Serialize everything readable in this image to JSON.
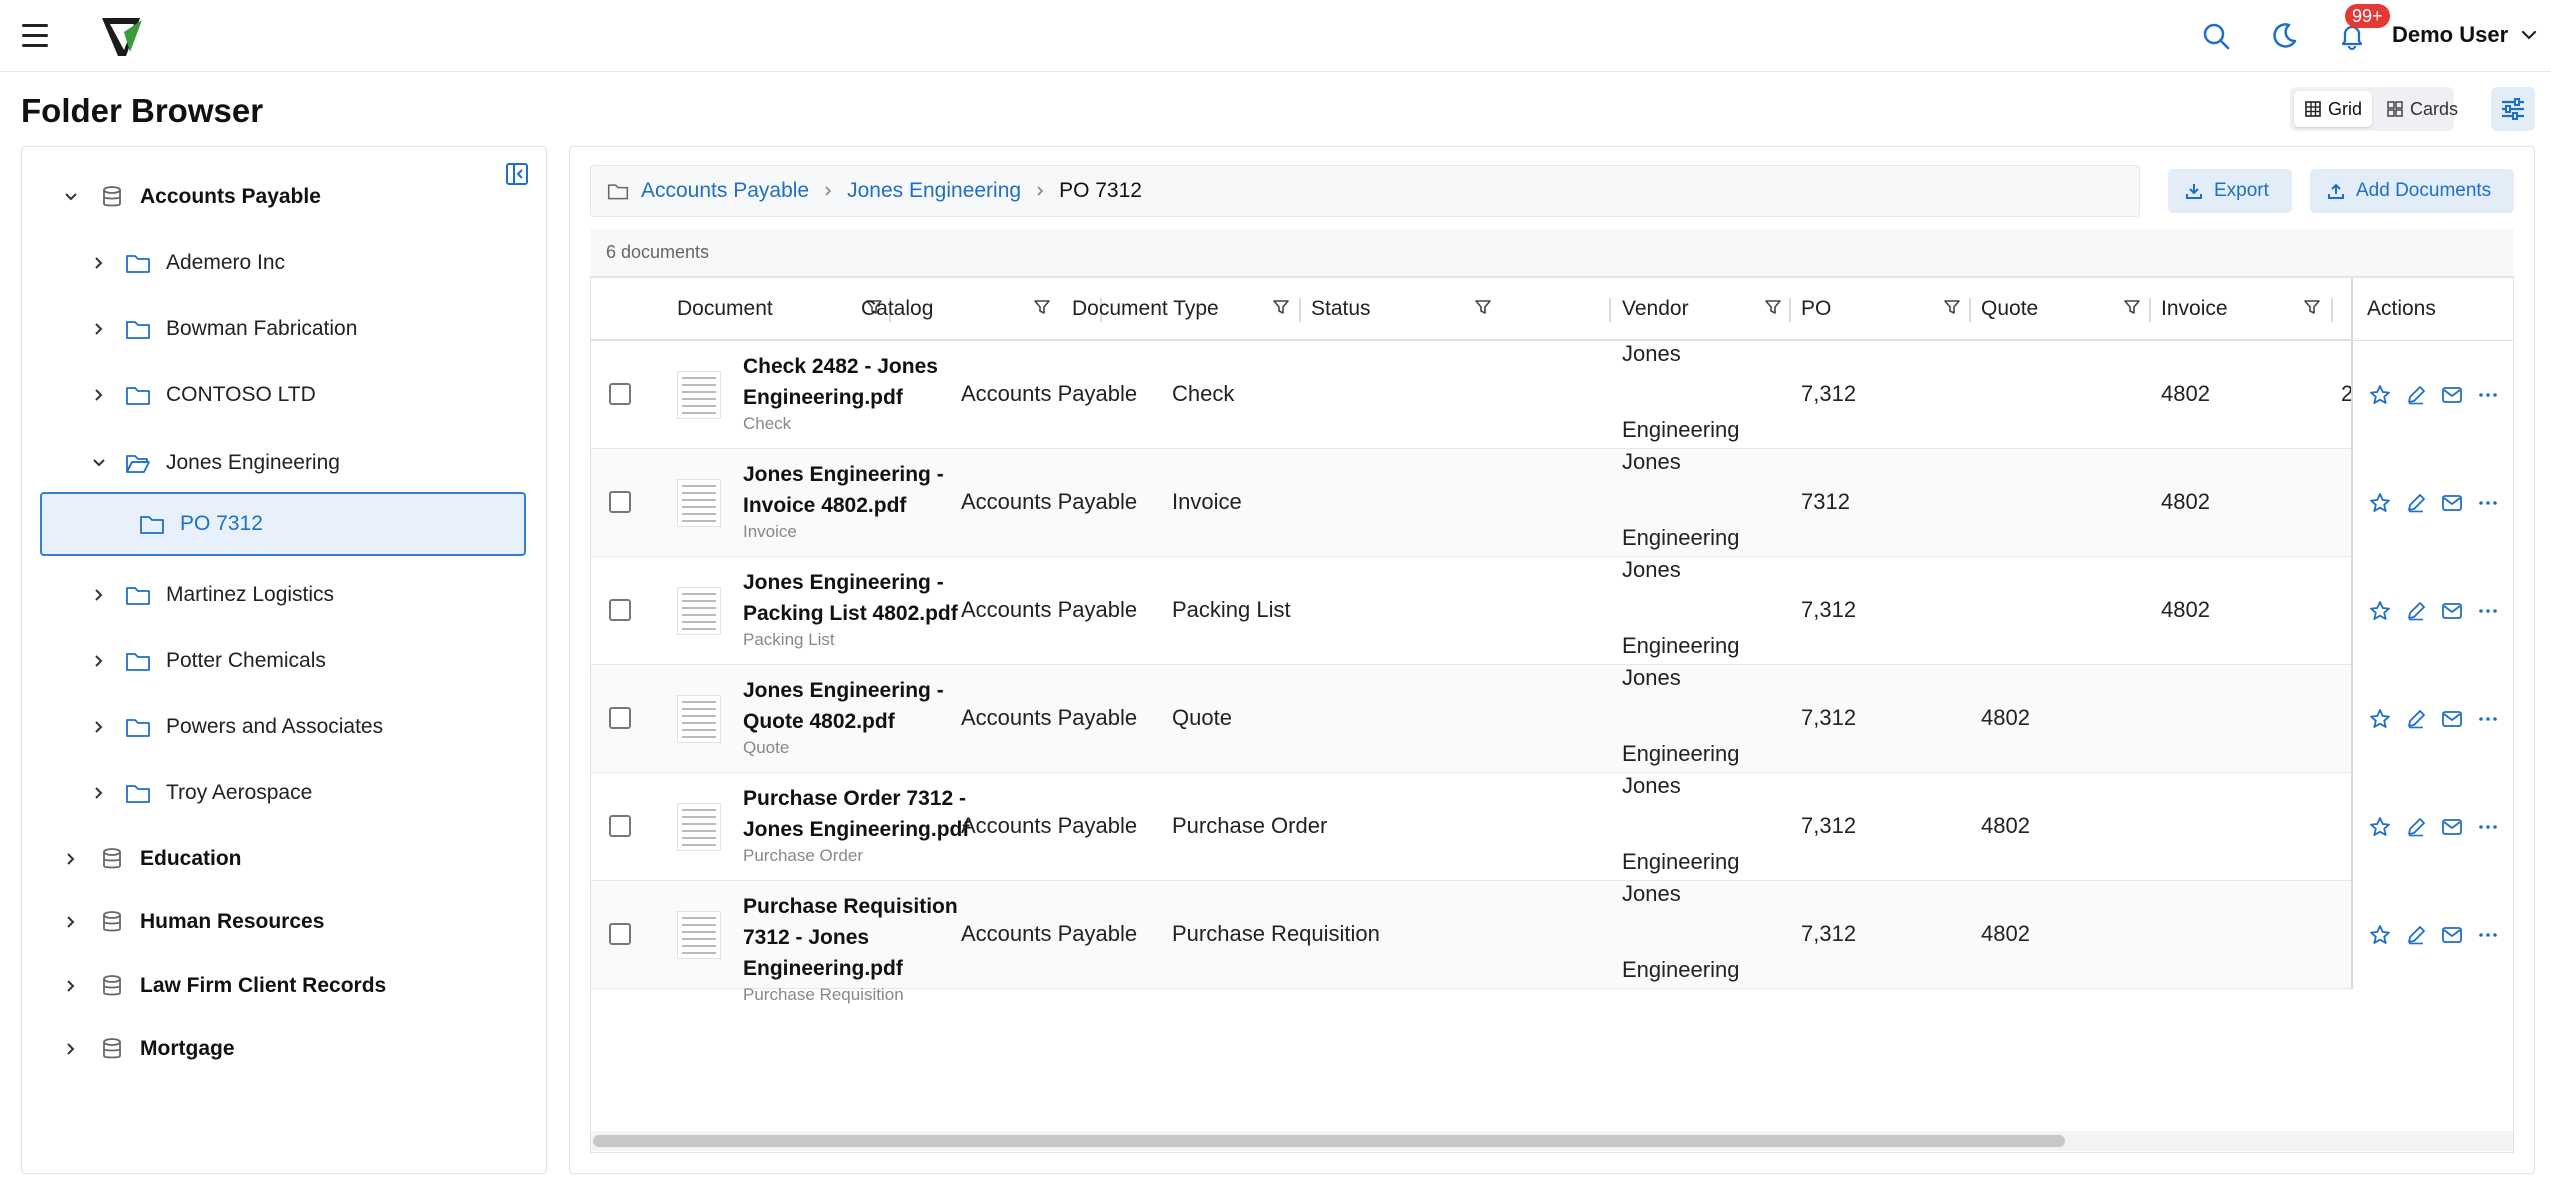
{
  "header": {
    "user_name": "Demo User",
    "notification_count": "99+",
    "icons": [
      "menu-icon",
      "search-icon",
      "moon-icon",
      "bell-icon",
      "chevron-down-icon"
    ]
  },
  "page": {
    "title": "Folder Browser",
    "view_grid_label": "Grid",
    "view_cards_label": "Cards"
  },
  "tree": {
    "roots": [
      {
        "label": "Accounts Payable",
        "expanded": true
      },
      {
        "label": "Education",
        "expanded": false
      },
      {
        "label": "Human Resources",
        "expanded": false
      },
      {
        "label": "Law Firm Client Records",
        "expanded": false
      },
      {
        "label": "Mortgage",
        "expanded": false
      }
    ],
    "children": [
      {
        "label": "Ademero Inc"
      },
      {
        "label": "Bowman Fabrication"
      },
      {
        "label": "CONTOSO LTD"
      },
      {
        "label": "Jones Engineering",
        "expanded": true
      },
      {
        "label": "PO 7312",
        "selected": true
      },
      {
        "label": "Martinez Logistics"
      },
      {
        "label": "Potter Chemicals"
      },
      {
        "label": "Powers and Associates"
      },
      {
        "label": "Troy Aerospace"
      }
    ]
  },
  "breadcrumb": {
    "items": [
      "Accounts Payable",
      "Jones Engineering"
    ],
    "current": "PO 7312"
  },
  "toolbar": {
    "export_label": "Export",
    "add_label": "Add Documents"
  },
  "doc_count": "6 documents",
  "columns": [
    "Document",
    "Catalog",
    "Document Type",
    "Status",
    "Vendor",
    "PO",
    "Quote",
    "Invoice",
    "Actions"
  ],
  "rows": [
    {
      "name": "Check 2482 - Jones Engineering.pdf",
      "sub": "Check",
      "catalog": "Accounts Payable",
      "type": "Check",
      "status": "",
      "vendor1": "Jones",
      "vendor2": "Engineering",
      "po": "7,312",
      "quote": "",
      "invoice": "4802",
      "cut": "2"
    },
    {
      "name": "Jones Engineering - Invoice 4802.pdf",
      "sub": "Invoice",
      "catalog": "Accounts Payable",
      "type": "Invoice",
      "status": "",
      "vendor1": "Jones",
      "vendor2": "Engineering",
      "po": "7312",
      "quote": "",
      "invoice": "4802",
      "cut": ""
    },
    {
      "name": "Jones Engineering - Packing List 4802.pdf",
      "sub": "Packing List",
      "catalog": "Accounts Payable",
      "type": "Packing List",
      "status": "",
      "vendor1": "Jones",
      "vendor2": "Engineering",
      "po": "7,312",
      "quote": "",
      "invoice": "4802",
      "cut": ""
    },
    {
      "name": "Jones Engineering - Quote 4802.pdf",
      "sub": "Quote",
      "catalog": "Accounts Payable",
      "type": "Quote",
      "status": "",
      "vendor1": "Jones",
      "vendor2": "Engineering",
      "po": "7,312",
      "quote": "4802",
      "invoice": "",
      "cut": ""
    },
    {
      "name": "Purchase Order 7312 - Jones Engineering.pdf",
      "sub": "Purchase Order",
      "catalog": "Accounts Payable",
      "type": "Purchase Order",
      "status": "",
      "vendor1": "Jones",
      "vendor2": "Engineering",
      "po": "7,312",
      "quote": "4802",
      "invoice": "",
      "cut": ""
    },
    {
      "name": "Purchase Requisition 7312 - Jones Engineering.pdf",
      "sub": "Purchase Requisition",
      "catalog": "Accounts Payable",
      "type": "Purchase Requisition",
      "status": "",
      "vendor1": "Jones",
      "vendor2": "Engineering",
      "po": "7,312",
      "quote": "4802",
      "invoice": "",
      "cut": ""
    }
  ],
  "colors": {
    "accent": "#1e6fc8",
    "badge": "#e53935",
    "selected_bg": "#e8f1fb"
  }
}
